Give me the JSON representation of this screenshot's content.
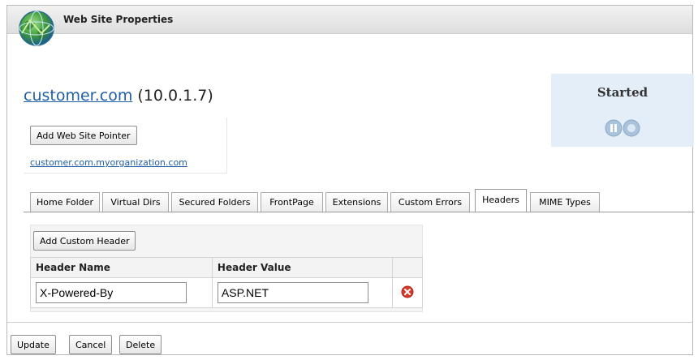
{
  "window": {
    "title": "Web Site Properties"
  },
  "site": {
    "name": "customer.com",
    "ip": "(10.0.1.7)"
  },
  "status": {
    "label": "Started",
    "pause_icon": "pause-icon",
    "stop_icon": "stop-icon",
    "accent": "#e4eef8"
  },
  "pointer": {
    "add_button": "Add Web Site Pointer",
    "link": "customer.com.myorganization.com"
  },
  "tabs": [
    {
      "label": "Home Folder"
    },
    {
      "label": "Virtual Dirs"
    },
    {
      "label": "Secured Folders"
    },
    {
      "label": "FrontPage"
    },
    {
      "label": "Extensions"
    },
    {
      "label": "Custom Errors"
    },
    {
      "label": "Headers",
      "active": true
    },
    {
      "label": "MIME Types"
    }
  ],
  "headers": {
    "add_button": "Add Custom Header",
    "columns": [
      "Header Name",
      "Header Value"
    ],
    "rows": [
      {
        "name": "X-Powered-By",
        "value": "ASP.NET",
        "delete_icon": "delete-icon"
      }
    ]
  },
  "footer": {
    "update": "Update",
    "cancel": "Cancel",
    "delete": "Delete"
  }
}
